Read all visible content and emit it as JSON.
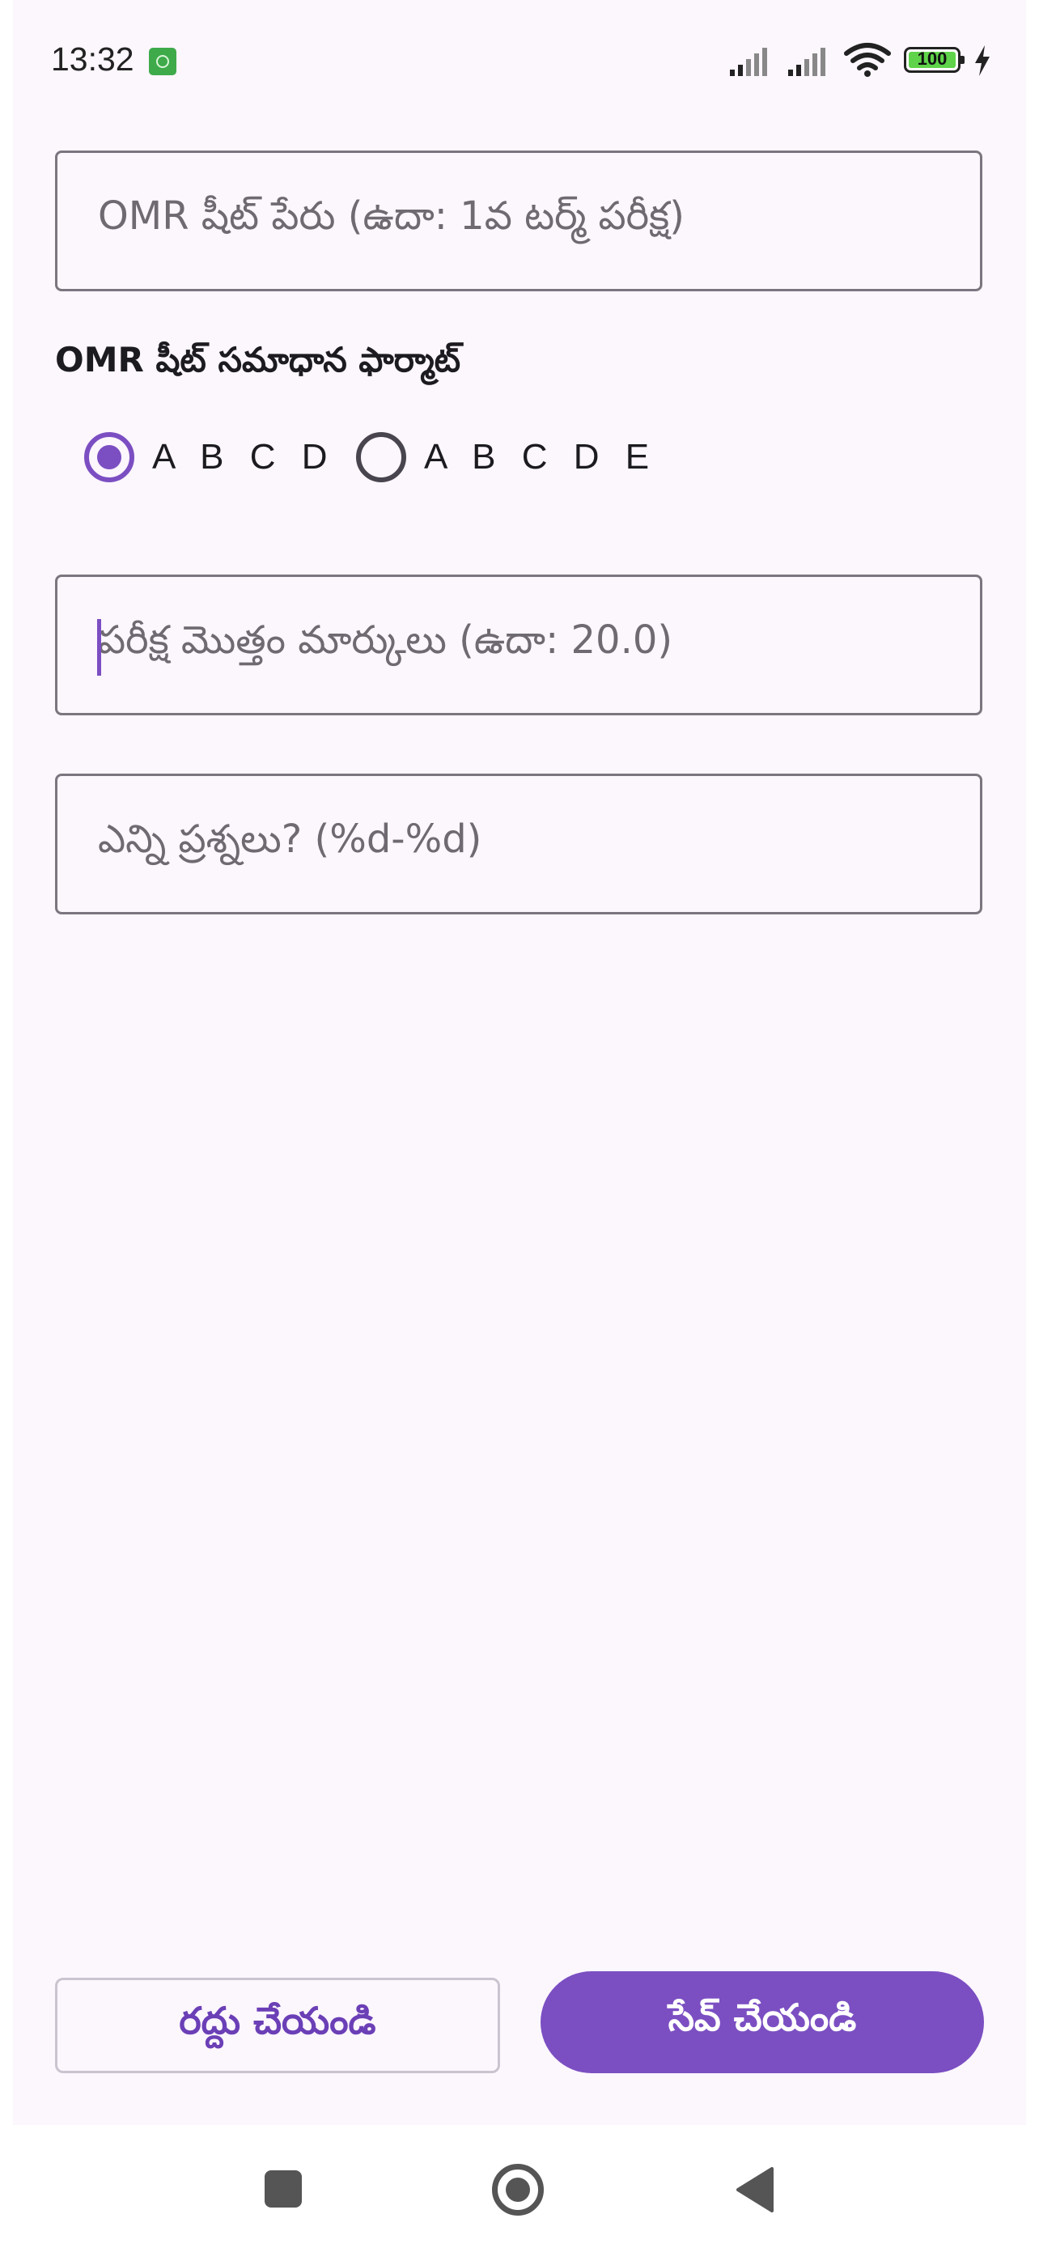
{
  "status_bar": {
    "time": "13:32",
    "battery": "100",
    "icons": [
      "app-notification-icon",
      "signal-icon",
      "signal-icon",
      "wifi-icon",
      "battery-icon",
      "charging-icon"
    ]
  },
  "form": {
    "sheet_name_placeholder": "OMR షీట్ పేరు (ఉదా: 1వ టర్మ్ పరీక్ష)",
    "format_label": "OMR షీట్ సమాధాన ఫార్మాట్",
    "format_options": [
      {
        "label": "A B C D",
        "selected": true
      },
      {
        "label": "A B C D E",
        "selected": false
      }
    ],
    "total_marks_placeholder": "పరీక్ష మొత్తం మార్కులు (ఉదా: 20.0)",
    "questions_placeholder": "ఎన్ని ప్రశ్నలు? (%d-%d)"
  },
  "actions": {
    "cancel_label": "రద్దు చేయండి",
    "save_label": "సేవ్ చేయండి"
  },
  "colors": {
    "accent": "#7b4fc2",
    "background": "#fcf6fd",
    "outline": "#7b757f"
  },
  "nav_bar": {
    "icons": [
      "recents-square-icon",
      "home-circle-icon",
      "back-triangle-icon"
    ]
  }
}
